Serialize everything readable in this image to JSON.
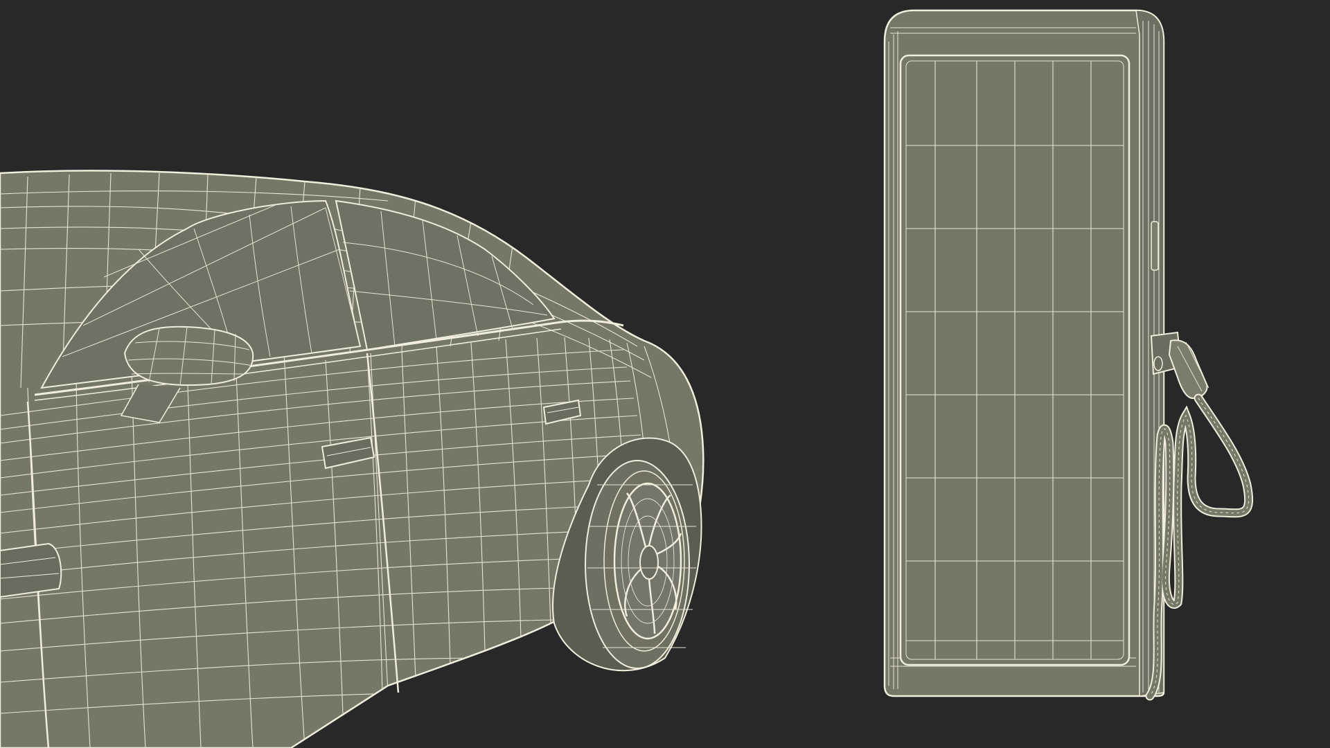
{
  "scene": {
    "background_color": "#282828",
    "mesh_fill_color": "#767867",
    "mesh_fill_dark": "#6a6c5d",
    "wire_color": "#f1eedd",
    "objects": [
      "electric-car-wireframe",
      "ev-charging-station-wireframe"
    ]
  }
}
